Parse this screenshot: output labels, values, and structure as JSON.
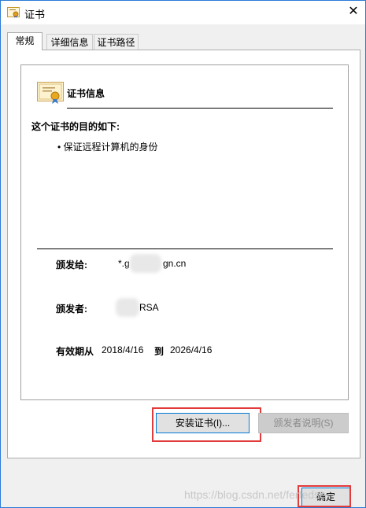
{
  "window": {
    "title": "证书",
    "close_glyph": "✕"
  },
  "tabs": [
    {
      "label": "常规",
      "active": true
    },
    {
      "label": "详细信息",
      "active": false
    },
    {
      "label": "证书路径",
      "active": false
    }
  ],
  "cert": {
    "info_title": "证书信息",
    "purpose_title": "这个证书的目的如下:",
    "purpose_items": [
      "• 保证远程计算机的身份"
    ],
    "issued_to_label": "颁发给:",
    "issued_to_value": "*.g",
    "issued_to_value_tail": "gn.cn",
    "issued_by_label": "颁发者:",
    "issued_by_value_tail": "RSA",
    "validity_label": "有效期从",
    "valid_from": "2018/4/16",
    "to_label": "到",
    "valid_to": "2026/4/16"
  },
  "buttons": {
    "install": "安装证书(I)...",
    "issuer_statement": "颁发者说明(S)",
    "ok": "确定"
  },
  "watermark": "https://blog.csdn.net/ferfedse",
  "colors": {
    "accent": "#0078d7",
    "highlight": "#e23b3b"
  }
}
